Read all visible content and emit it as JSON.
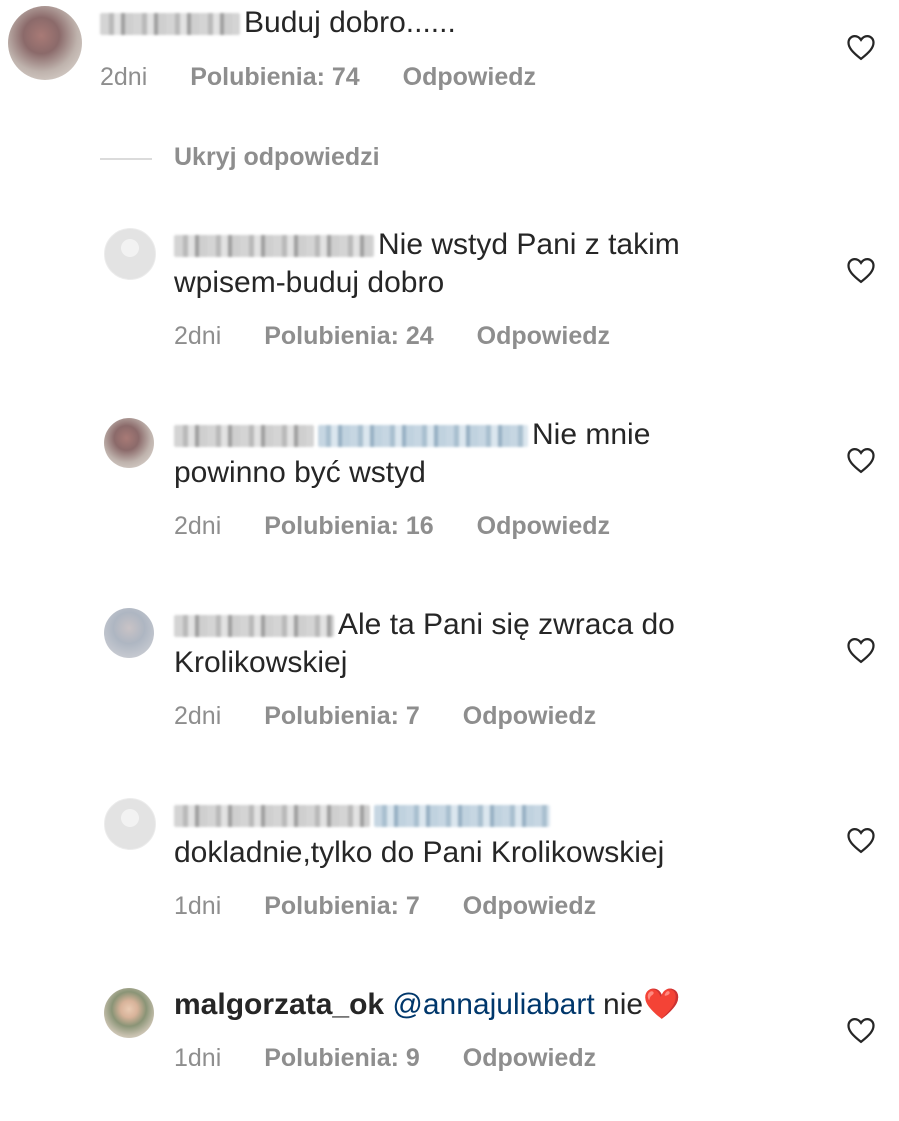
{
  "hide_replies_label": "Ukryj odpowiedzi",
  "likes_prefix": "Polubienia:",
  "reply_label": "Odpowiedz",
  "comments": [
    {
      "text": "Buduj dobro......",
      "time": "2dni",
      "likes": "74"
    },
    {
      "text": "Nie wstyd Pani z takim wpisem-buduj dobro",
      "time": "2dni",
      "likes": "24"
    },
    {
      "text": "Nie mnie powinno być wstyd",
      "time": "2dni",
      "likes": "16"
    },
    {
      "text": "Ale ta Pani się zwraca do Krolikowskiej",
      "time": "2dni",
      "likes": "7"
    },
    {
      "text": "dokladnie,tylko do Pani Krolikowskiej",
      "time": "1dni",
      "likes": "7"
    },
    {
      "username": "malgorzata_ok",
      "mention": "@annajuliabart",
      "text": "nie",
      "emoji": "❤️",
      "time": "1dni",
      "likes": "9"
    }
  ],
  "icons": {
    "like": "heart-outline-icon",
    "emoji": "red-heart-emoji"
  },
  "colors": {
    "text": "#262626",
    "meta": "#8e8e8e",
    "mention": "#00376b",
    "heart_emoji": "#e0243a"
  }
}
